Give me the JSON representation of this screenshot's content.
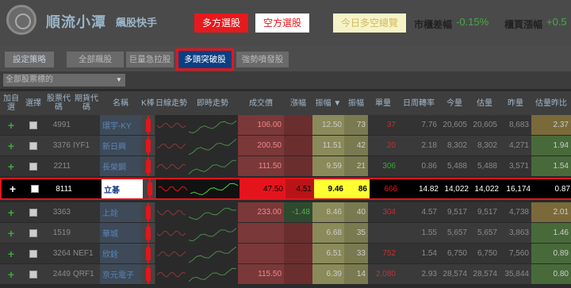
{
  "header": {
    "brand": "順流小潭",
    "brand_sub": "飆股快手",
    "long_btn": "多方選股",
    "short_btn": "空方選股",
    "today_btn": "今日多空總覽",
    "market_diff_label": "市櫃差幅",
    "market_diff_value": "-0.15%",
    "otc_change_label": "櫃買漲幅",
    "otc_change_value": "+0.5"
  },
  "tabs": [
    "設定策略",
    "全部飆股",
    "巨量急拉股",
    "多頭突破股",
    "強勢噴發股"
  ],
  "filter": {
    "selected": "全部股票標的",
    "arrow": "▼"
  },
  "columns": [
    "加自選",
    "選擇",
    "股票代碼",
    "期貨代碼",
    "名稱",
    "K棒",
    "日線走勢",
    "即時走勢",
    "成交價",
    "漲幅",
    "振幅 ▼",
    "振幅",
    "單量",
    "日周轉率",
    "今量",
    "估量",
    "昨量",
    "估量昨比"
  ],
  "rows": [
    {
      "code": "4991",
      "fut": "",
      "name": "環宇-KY",
      "close": "106.00",
      "chg": "",
      "amp": "12.50",
      "amp2": "73",
      "unit": "37",
      "turn": "7.76",
      "vol": "20,605",
      "est": "20,605",
      "prev": "8,683",
      "ratio": "2.37"
    },
    {
      "code": "3376",
      "fut": "IYF1",
      "name": "新日興",
      "close": "200.50",
      "chg": "",
      "amp": "11.51",
      "amp2": "42",
      "unit": "20",
      "turn": "2.18",
      "vol": "8,302",
      "est": "8,302",
      "prev": "4,271",
      "ratio": "1.94"
    },
    {
      "code": "2211",
      "fut": "",
      "name": "長榮鋼",
      "close": "111.50",
      "chg": "",
      "amp": "9.59",
      "amp2": "21",
      "unit": "306",
      "turn": "0.86",
      "vol": "5,488",
      "est": "5,488",
      "prev": "3,571",
      "ratio": "1.54"
    },
    {
      "code": "8111",
      "fut": "",
      "name": "立碁",
      "close": "47.50",
      "chg": "4.51",
      "amp": "9.46",
      "amp2": "86",
      "unit": "666",
      "turn": "14.82",
      "vol": "14,022",
      "est": "14,022",
      "prev": "16,174",
      "ratio": "0.87"
    },
    {
      "code": "3363",
      "fut": "",
      "name": "上詮",
      "close": "233.00",
      "chg": "-1.48",
      "amp": "8.46",
      "amp2": "40",
      "unit": "304",
      "turn": "4.57",
      "vol": "9,517",
      "est": "9,517",
      "prev": "4,738",
      "ratio": "2.01"
    },
    {
      "code": "1519",
      "fut": "",
      "name": "華城",
      "close": "",
      "chg": "",
      "amp": "6.68",
      "amp2": "35",
      "unit": "",
      "turn": "1.55",
      "vol": "5,657",
      "est": "5,657",
      "prev": "3,863",
      "ratio": "1.46"
    },
    {
      "code": "3264",
      "fut": "NEF1",
      "name": "欣銓",
      "close": "",
      "chg": "",
      "amp": "6.51",
      "amp2": "33",
      "unit": "752",
      "turn": "1.54",
      "vol": "6,750",
      "est": "6,750",
      "prev": "7,560",
      "ratio": "0.89"
    },
    {
      "code": "2449",
      "fut": "QRF1",
      "name": "京元電子",
      "close": "115.50",
      "chg": "",
      "amp": "6.39",
      "amp2": "14",
      "unit": "2,080",
      "turn": "2.93",
      "vol": "28,574",
      "est": "28,574",
      "prev": "35,844",
      "ratio": "0.80"
    }
  ],
  "colors": {
    "accent_red": "#e5141c",
    "tab_blue": "#0a3f83",
    "highlight_yellow": "#ffff33",
    "up_green": "#48a848"
  },
  "icons": {
    "add": "plus-icon",
    "select": "checkbox-icon",
    "dropdown": "chevron-down-icon"
  }
}
